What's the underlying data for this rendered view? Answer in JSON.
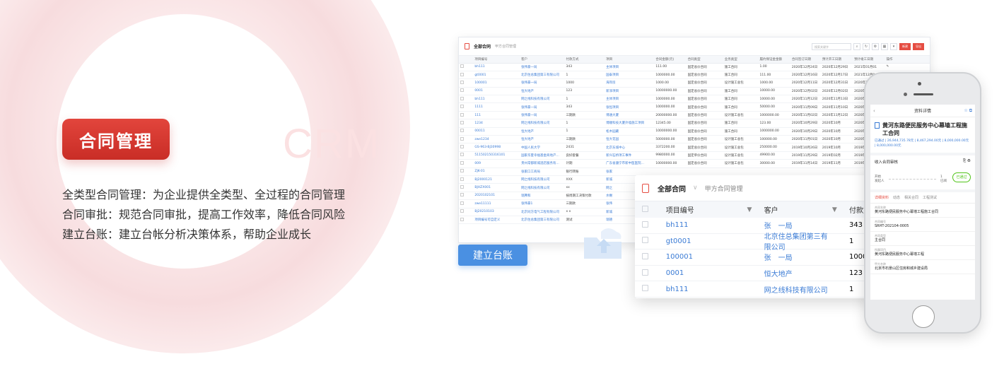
{
  "hero": {
    "title": "合同管理",
    "watermark": "CRM",
    "features": [
      "全类型合同管理：为企业提供全类型、全过程的合同管理",
      "合同审批：规范合同审批，提高工作效率，降低合同风险",
      "建立台账：建立台帐分析决策体系，帮助企业成长"
    ],
    "ledger_button": "建立台账"
  },
  "desktop": {
    "title": "全部合同",
    "subtitle": "甲方合同管理",
    "search_placeholder": "搜索关键字",
    "actions": [
      "新建",
      "导出"
    ],
    "columns": [
      "项目编号",
      "客户",
      "付款方式",
      "项目",
      "合同金额(元)",
      "合同类型",
      "业务类型",
      "履约保证金金额",
      "合同签订日期",
      "预计开工日期",
      "预计竣工日期",
      "操作"
    ],
    "rows": [
      [
        "bh111",
        "张伟豪一局",
        "343",
        "主体项目",
        "111.00",
        "固定总价合同",
        "施工合同",
        "1.00",
        "2020年12月24日",
        "2020年12月29日",
        "2021年01月01"
      ],
      [
        "gt0001",
        "北京住总集团第三有限公司",
        "1",
        "国泰项目",
        "1000000.00",
        "固定总价合同",
        "施工合同",
        "111.00",
        "2020年12月16日",
        "2020年12月17日",
        "2021年12月0"
      ],
      [
        "100001",
        "张伟豪一局",
        "1000",
        "海岸房",
        "1000.00",
        "固定总价合同",
        "设计施工总包",
        "1000.00",
        "2020年12月11日",
        "2020年12月31日",
        "2020年12月3"
      ],
      [
        "0001",
        "恒大地产",
        "123",
        "新添项目",
        "10000000.00",
        "固定总价合同",
        "施工合同",
        "10000.00",
        "2020年12月02日",
        "2020年12月02日",
        "2020年12月0"
      ],
      [
        "bh111",
        "网之线科技有限公司",
        "1",
        "主体项目",
        "1000000.00",
        "固定总价合同",
        "施工合同",
        "10000.00",
        "2020年11月12日",
        "2020年11月13日",
        "2020年11月"
      ],
      [
        "1111",
        "张伟豪一局",
        "343",
        "张恒项目",
        "1000000.00",
        "固定总价合同",
        "施工合同",
        "50000.00",
        "2020年11月09日",
        "2020年11月10日",
        "2020年11月"
      ],
      [
        "111",
        "张伟豪一局",
        "三期款",
        "博通大厦",
        "20000000.00",
        "固定总价合同",
        "设计施工总包",
        "1000000.00",
        "2020年11月02日",
        "2020年11月12日",
        "2020年11"
      ],
      [
        "1234",
        "网之线科技有限公司",
        "1",
        "博顺科技大厦外墙施工项目",
        "12345.00",
        "固定总价合同",
        "施工合同",
        "123.00",
        "2020年10月29日",
        "2020年10月",
        "2020年10"
      ],
      [
        "00011",
        "恒大地产",
        "1",
        "松木园藏",
        "10000000.00",
        "固定总价合同",
        "施工合同",
        "1000000.00",
        "2020年10月29日",
        "2020年10月",
        "2020年10"
      ],
      [
        "zwe1234",
        "恒大地产",
        "三期款",
        "恒大花园",
        "5000000.00",
        "固定总价合同",
        "设计施工总包",
        "100000.00",
        "2020年11月01日",
        "2020年10月",
        "2020年10"
      ],
      [
        "GS-963-BJ30998",
        "中国人民大学",
        "2431",
        "北京东城中心",
        "3372200.00",
        "固定总价合同",
        "设计施工总包",
        "250000.00",
        "2019年10月26日",
        "2019年10月",
        "2019年10"
      ],
      [
        "511502150316101",
        "国家华夏幸福基金商地产...",
        "良好套餐",
        "新兴石桥项工事件",
        "9980000.00",
        "固定单价合同",
        "设计施工总包",
        "49900.00",
        "2019年11月29日",
        "2019年02月",
        "2019年02"
      ],
      [
        "009",
        "贵州常都新城酒店服务有...",
        "计期",
        "广东省遵宁市新中医医院...",
        "10000000.00",
        "固定总价合同",
        "设计施工总包",
        "30000.00",
        "2019年11月14日",
        "2019年11月",
        "2019年11"
      ],
      [
        "ZJK-01",
        "张家口工商局",
        "银行转账",
        "张家",
        "",
        "",
        "",
        "",
        "",
        "",
        ""
      ],
      [
        "BJ2000121",
        "网之线科技有限公司",
        "XXX",
        "新诚",
        "",
        "",
        "",
        "",
        "",
        "",
        ""
      ],
      [
        "BJHZX001",
        "网之线科技有限公司",
        "xx",
        "网之",
        "",
        "",
        "",
        "",
        "",
        "",
        ""
      ],
      [
        "2020102101",
        "瑞弗和",
        "按周期工决策付款",
        "水榭",
        "",
        "",
        "",
        "",
        "",
        "",
        ""
      ],
      [
        "zwe11111",
        "张伟豪1",
        "三期款",
        "张伟",
        "",
        "",
        "",
        "",
        "",
        "",
        ""
      ],
      [
        "BJ20210103",
        "北京同方电气工程有限公司",
        "x x",
        "新诚",
        "",
        "",
        "",
        "",
        "",
        "",
        ""
      ],
      [
        "项目编号可自定义",
        "北京住总集团第三有限公司",
        "测试",
        "瑞德",
        "",
        "",
        "",
        "",
        "",
        "",
        ""
      ]
    ]
  },
  "popup": {
    "title": "全部合同",
    "subtitle": "甲方合同管理",
    "columns": [
      "项目编号",
      "客户",
      "付款方"
    ],
    "rows": [
      [
        "bh111",
        "张　一局",
        "343"
      ],
      [
        "gt0001",
        "北京住总集团第三有限公司",
        "1"
      ],
      [
        "100001",
        "张　一局",
        "1000"
      ],
      [
        "0001",
        "恒大地产",
        "123"
      ],
      [
        "bh111",
        "网之线科技有限公司",
        "1"
      ]
    ]
  },
  "phone": {
    "nav_title": "资料详情",
    "project_title": "黄河东路便民服务中心幕墙工程施工合同",
    "amount_line": "已通过 | 26,944,735.78元 | 8,467,294.00元 | 8,000,000.00元 | 8,000,000.00元",
    "approval_section": "收入合同审核",
    "flow_left_label": "开始",
    "flow_left_sub": "发起人",
    "flow_mid_value": "1",
    "flow_mid_sub": "已阅",
    "approved_stamp": "已通过",
    "tabs": [
      "详细资料",
      "动态",
      "相关合同",
      "工程测试"
    ],
    "fields": [
      {
        "k": "合同名称",
        "v": "黄河东路便民服务中心幕墙工程施工合同"
      },
      {
        "k": "合同编号",
        "v": "SRHT-202104-0005"
      },
      {
        "k": "合同类型",
        "v": "主合同"
      },
      {
        "k": "所属项目",
        "v": "黄河东路便民服务中心幕墙工程"
      },
      {
        "k": "甲方名称",
        "v": "北京市石景山区住房和城乡建设局"
      }
    ]
  }
}
